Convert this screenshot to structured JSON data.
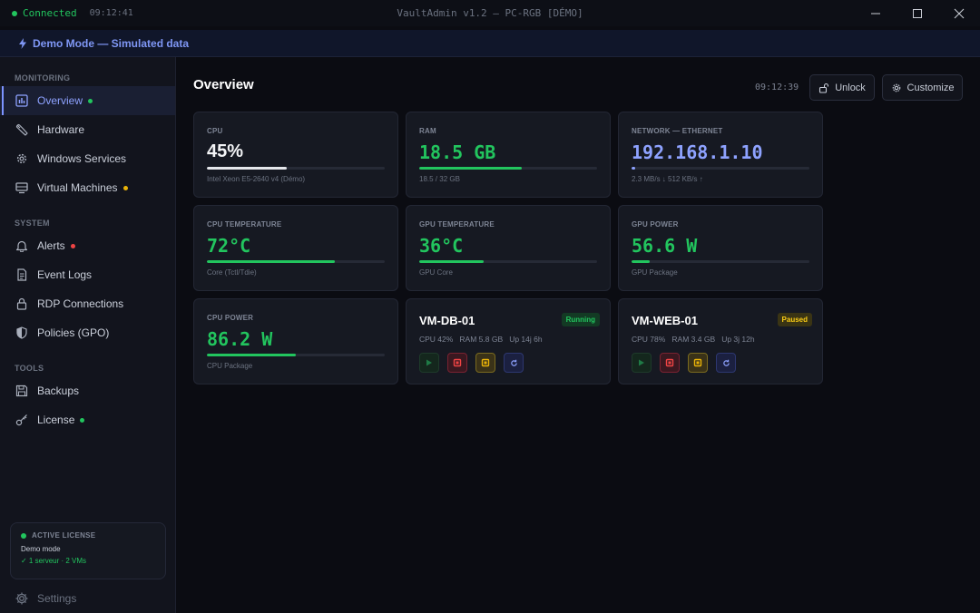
{
  "titlebar": {
    "status": "Connected",
    "time": "09:12:41",
    "title": "VaultAdmin v1.2 — PC-RGB [DÉMO]"
  },
  "banner": {
    "text": "Demo Mode — Simulated data"
  },
  "sidebar": {
    "sections": [
      {
        "title": "MONITORING",
        "items": [
          {
            "label": "Overview",
            "icon": "chart-icon",
            "active": true,
            "dot": "#22c55e"
          },
          {
            "label": "Hardware",
            "icon": "wrench-icon"
          },
          {
            "label": "Windows Services",
            "icon": "gear-icon"
          },
          {
            "label": "Virtual Machines",
            "icon": "server-icon",
            "dot": "#eab308"
          }
        ]
      },
      {
        "title": "SYSTEM",
        "items": [
          {
            "label": "Alerts",
            "icon": "bell-icon",
            "dot": "#ef4444"
          },
          {
            "label": "Event Logs",
            "icon": "document-icon"
          },
          {
            "label": "RDP Connections",
            "icon": "lock-icon"
          },
          {
            "label": "Policies (GPO)",
            "icon": "shield-icon"
          }
        ]
      },
      {
        "title": "TOOLS",
        "items": [
          {
            "label": "Backups",
            "icon": "save-icon"
          },
          {
            "label": "License",
            "icon": "key-icon",
            "dot": "#22c55e"
          }
        ]
      }
    ],
    "license": {
      "title": "ACTIVE LICENSE",
      "mode": "Demo mode",
      "summary": "✓ 1 serveur · 2 VMs"
    },
    "settings": "Settings"
  },
  "header": {
    "title": "Overview",
    "clock": "09:12:39",
    "unlock": "Unlock",
    "customize": "Customize"
  },
  "cards": [
    {
      "label": "CPU",
      "value": "45%",
      "sub": "Intel Xeon E5-2640 v4 (Démo)",
      "progress": 0.45,
      "color": "#f3f4f6",
      "bar": "#e5e7eb"
    },
    {
      "label": "RAM",
      "value": "18.5 GB",
      "sub": "18.5 / 32 GB",
      "progress": 0.578,
      "color": "#22c55e",
      "bar": "#22c55e",
      "mono": true
    },
    {
      "label": "NETWORK — Ethernet",
      "value": "192.168.1.10",
      "sub": "2.3 MB/s ↓  512 KB/s ↑",
      "progress": 0.02,
      "color": "#8ea2ff",
      "bar": "#8ea2ff",
      "mono": true
    },
    {
      "label": "CPU TEMPERATURE",
      "value": "72°C",
      "sub": "Core (Tctl/Tdie)",
      "progress": 0.72,
      "color": "#22c55e",
      "bar": "#22c55e",
      "mono": true
    },
    {
      "label": "GPU TEMPERATURE",
      "value": "36°C",
      "sub": "GPU Core",
      "progress": 0.36,
      "color": "#22c55e",
      "bar": "#22c55e",
      "mono": true
    },
    {
      "label": "GPU POWER",
      "value": "56.6 W",
      "sub": "GPU Package",
      "progress": 0.1,
      "color": "#22c55e",
      "bar": "#22c55e",
      "mono": true
    },
    {
      "label": "CPU POWER",
      "value": "86.2 W",
      "sub": "CPU Package",
      "progress": 0.5,
      "color": "#22c55e",
      "bar": "#22c55e",
      "mono": true
    }
  ],
  "vms": [
    {
      "name": "VM-DB-01",
      "status": "Running",
      "status_color": "#22c55e",
      "status_bg": "#133a24",
      "stats": "CPU 42%   RAM 5.8 GB   Up 14j 6h"
    },
    {
      "name": "VM-WEB-01",
      "status": "Paused",
      "status_color": "#facc15",
      "status_bg": "#3a3414",
      "stats": "CPU 78%   RAM 3.4 GB   Up 3j 12h"
    }
  ]
}
